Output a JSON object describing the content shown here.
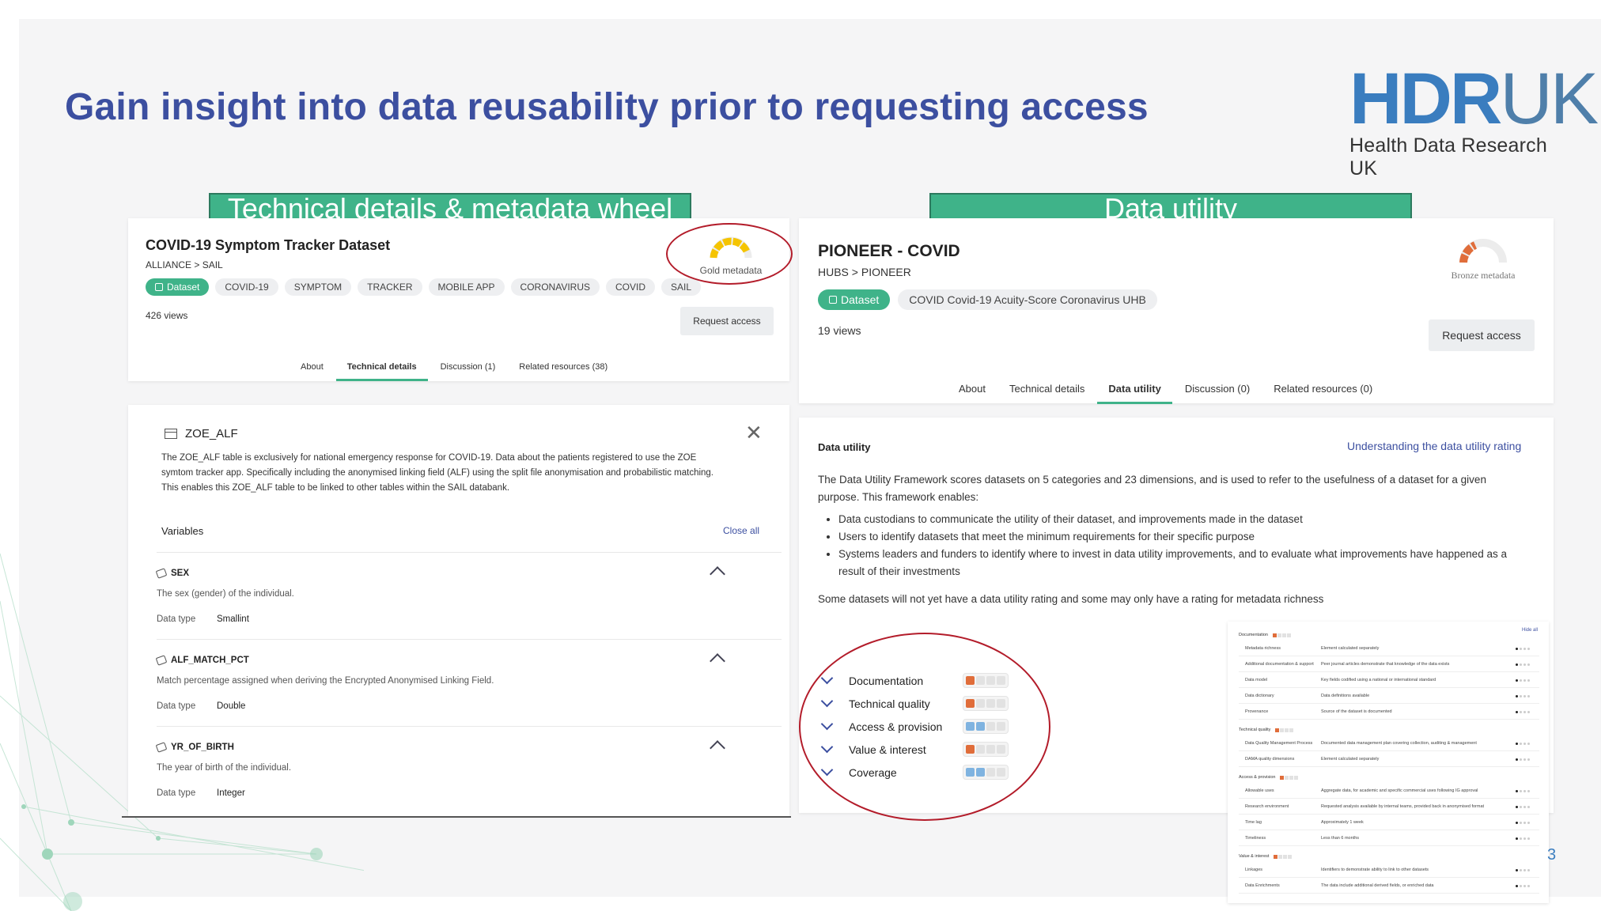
{
  "slide": {
    "title": "Gain insight into data reusability prior to requesting access",
    "page_number": "3"
  },
  "logo": {
    "word_hdr": "HDR",
    "word_uk": "UK",
    "subtitle": "Health Data Research UK"
  },
  "banners": {
    "left": "Technical details & metadata wheel",
    "right": "Data utility"
  },
  "colors": {
    "accent_green": "#3fb389",
    "title_blue": "#3c4fa0",
    "gold": "#f5c400",
    "bronze": "#e06d3a",
    "util_blue": "#7fb3e0",
    "util_orange": "#e06d3a",
    "ring_red": "#b31c2a"
  },
  "left_dataset": {
    "title": "COVID-19 Symptom Tracker Dataset",
    "breadcrumb": "ALLIANCE > SAIL",
    "tags": [
      "Dataset",
      "COVID-19",
      "SYMPTOM",
      "TRACKER",
      "MOBILE APP",
      "CORONAVIRUS",
      "COVID",
      "SAIL"
    ],
    "views": "426 views",
    "request_label": "Request access",
    "metadata_label": "Gold metadata",
    "metadata_level": "gold",
    "tabs": [
      "About",
      "Technical details",
      "Discussion (1)",
      "Related resources (38)"
    ],
    "active_tab": "Technical details"
  },
  "technical": {
    "table_name": "ZOE_ALF",
    "description": "The ZOE_ALF table is exclusively for national emergency response for COVID-19. Data about the patients registered to use the ZOE symtom tracker app. Specifically including the anonymised linking field (ALF) using the split file anonymisation and probabilistic matching. This enables this ZOE_ALF table to be linked to other tables within the SAIL databank.",
    "variables_label": "Variables",
    "close_all": "Close all",
    "data_type_label": "Data type",
    "variables": [
      {
        "name": "SEX",
        "description": "The sex (gender) of the individual.",
        "type": "Smallint"
      },
      {
        "name": "ALF_MATCH_PCT",
        "description": "Match percentage assigned when deriving the Encrypted Anonymised Linking Field.",
        "type": "Double"
      },
      {
        "name": "YR_OF_BIRTH",
        "description": "The year of birth of the individual.",
        "type": "Integer"
      }
    ]
  },
  "right_dataset": {
    "title": "PIONEER - COVID",
    "breadcrumb": "HUBS > PIONEER",
    "tags": [
      "Dataset",
      "COVID Covid-19 Acuity-Score Coronavirus UHB"
    ],
    "views": "19 views",
    "request_label": "Request access",
    "metadata_label": "Bronze metadata",
    "metadata_level": "bronze",
    "tabs": [
      "About",
      "Technical details",
      "Data utility",
      "Discussion (0)",
      "Related resources (0)"
    ],
    "active_tab": "Data utility"
  },
  "utility": {
    "heading": "Data utility",
    "link": "Understanding the data utility rating",
    "intro": "The Data Utility Framework scores datasets on 5 categories and 23 dimensions, and is used to refer to the usefulness of a dataset for a given purpose. This framework enables:",
    "bullets": [
      "Data custodians to communicate the utility of their dataset, and improvements made in the dataset",
      "Users to identify datasets that meet the minimum requirements for their specific purpose",
      "Systems leaders and funders to identify where to invest in data utility improvements, and to evaluate what improvements have happened as a result of their investments"
    ],
    "note": "Some datasets will not yet have a data utility rating and some may only have a rating for metadata richness",
    "categories": [
      {
        "label": "Documentation",
        "level": 1,
        "color": "orange"
      },
      {
        "label": "Technical quality",
        "level": 1,
        "color": "orange"
      },
      {
        "label": "Access & provision",
        "level": 2,
        "color": "blue"
      },
      {
        "label": "Value & interest",
        "level": 1,
        "color": "orange"
      },
      {
        "label": "Coverage",
        "level": 2,
        "color": "blue"
      }
    ]
  },
  "mini_detail": {
    "hide_all": "Hide all",
    "sections": [
      {
        "title": "Documentation",
        "rows": [
          [
            "Metadata richness",
            "Element calculated separately"
          ],
          [
            "Additional documentation & support",
            "Peer journal articles demonstrate that knowledge of the data exists"
          ],
          [
            "Data model",
            "Key fields codified using a national or international standard"
          ],
          [
            "Data dictionary",
            "Data definitions available"
          ],
          [
            "Provenance",
            "Source of the dataset is documented"
          ]
        ]
      },
      {
        "title": "Technical quality",
        "rows": [
          [
            "Data Quality Management Process",
            "Documented data management plan covering collection, auditing & management"
          ],
          [
            "DAMA quality dimensions",
            "Element calculated separately"
          ]
        ]
      },
      {
        "title": "Access & provision",
        "rows": [
          [
            "Allowable uses",
            "Aggregate data, for academic and specific commercial uses following IG approval"
          ],
          [
            "Research environment",
            "Requested analysis available by internal teams, provided back in anonymised format"
          ],
          [
            "Time lag",
            "Approximately 1 week"
          ],
          [
            "Timeliness",
            "Less than 6 months"
          ]
        ]
      },
      {
        "title": "Value & interest",
        "rows": [
          [
            "Linkages",
            "Identifiers to demonstrate ability to link to other datasets"
          ],
          [
            "Data Enrichments",
            "The data include additional derived fields, or enriched data"
          ]
        ]
      }
    ]
  }
}
